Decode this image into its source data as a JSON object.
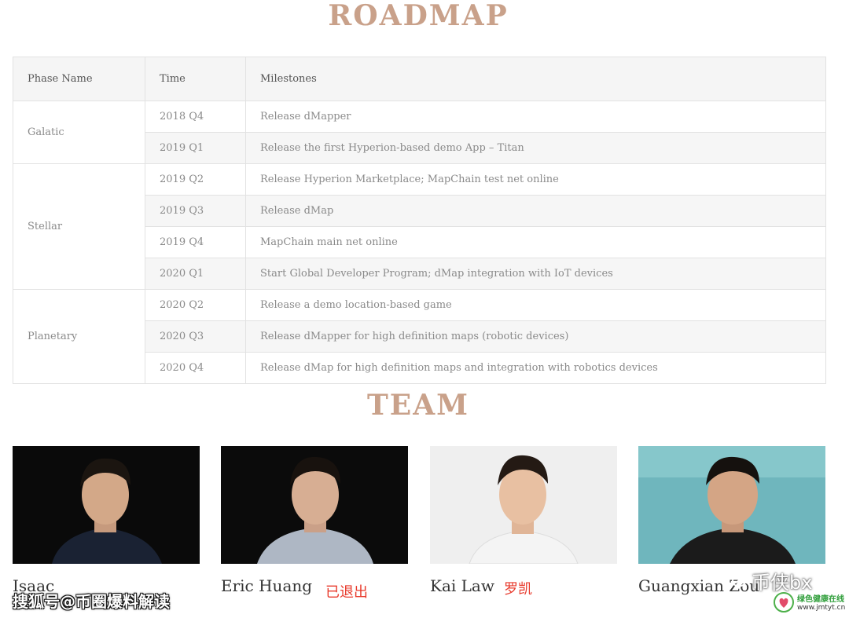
{
  "colors": {
    "heading": "#c9a18a",
    "note_red": "#e8392b"
  },
  "roadmap": {
    "title": "ROADMAP",
    "headers": [
      "Phase Name",
      "Time",
      "Milestones"
    ],
    "phases": [
      {
        "name": "Galatic",
        "rows": [
          {
            "time": "2018 Q4",
            "milestone": "Release dMapper"
          },
          {
            "time": "2019 Q1",
            "milestone": "Release the first Hyperion-based demo App – Titan"
          }
        ]
      },
      {
        "name": "Stellar",
        "rows": [
          {
            "time": "2019 Q2",
            "milestone": "Release Hyperion Marketplace; MapChain test net online"
          },
          {
            "time": "2019 Q3",
            "milestone": "Release dMap"
          },
          {
            "time": "2019 Q4",
            "milestone": "MapChain main net online"
          },
          {
            "time": "2020 Q1",
            "milestone": "Start Global Developer Program; dMap integration with IoT devices"
          }
        ]
      },
      {
        "name": "Planetary",
        "rows": [
          {
            "time": "2020 Q2",
            "milestone": "Release a demo location-based game"
          },
          {
            "time": "2020 Q3",
            "milestone": "Release dMapper for high definition maps (robotic devices)"
          },
          {
            "time": "2020 Q4",
            "milestone": "Release dMap for high definition maps and integration with robotics devices"
          }
        ]
      }
    ]
  },
  "team": {
    "title": "TEAM",
    "members": [
      {
        "name": "Isaac",
        "note": "",
        "photo_icon": "portrait-photo"
      },
      {
        "name": "Eric Huang",
        "note": "已退出",
        "photo_icon": "portrait-photo"
      },
      {
        "name": "Kai Law",
        "note": "罗凯",
        "photo_icon": "portrait-photo"
      },
      {
        "name": "Guangxian Zou",
        "note": "",
        "photo_icon": "portrait-photo"
      }
    ]
  },
  "watermarks": {
    "left": "搜狐号@币圈爆料解读",
    "right": "币侠bx",
    "right_icon": "wechat-icon",
    "logo_text": "绿色健康在线",
    "logo_url": "www.jmtyt.cn"
  }
}
